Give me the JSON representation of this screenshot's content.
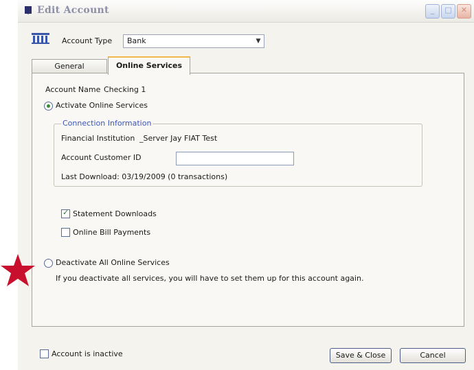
{
  "window": {
    "title": "Edit Account"
  },
  "account_type": {
    "label": "Account Type",
    "value": "Bank"
  },
  "tabs": [
    {
      "label": "General"
    },
    {
      "label": "Online Services"
    }
  ],
  "online_services": {
    "account_name_label": "Account Name",
    "account_name_value": "Checking 1",
    "activate_label": "Activate Online Services",
    "connection_info": {
      "legend": "Connection Information",
      "fi_label": "Financial Institution",
      "fi_value": "_Server Jay FIAT Test",
      "customer_id_label": "Account Customer ID",
      "customer_id_value": "",
      "last_download": "Last Download: 03/19/2009 (0 transactions)"
    },
    "statement_downloads_label": "Statement Downloads",
    "bill_payments_label": "Online Bill Payments",
    "deactivate_label": "Deactivate All Online Services",
    "deactivate_note": "If you deactivate all services, you will have to set them up for this account again."
  },
  "footer": {
    "inactive_label": "Account is inactive",
    "save_label": "Save & Close",
    "cancel_label": "Cancel"
  },
  "colors": {
    "accent_tab": "#f4b84a",
    "star": "#c8102e",
    "group_legend": "#3a55b8"
  },
  "icons": [
    "bank-icon",
    "minimize-icon",
    "maximize-icon",
    "close-icon",
    "chevron-down-icon",
    "star-marker-icon"
  ]
}
